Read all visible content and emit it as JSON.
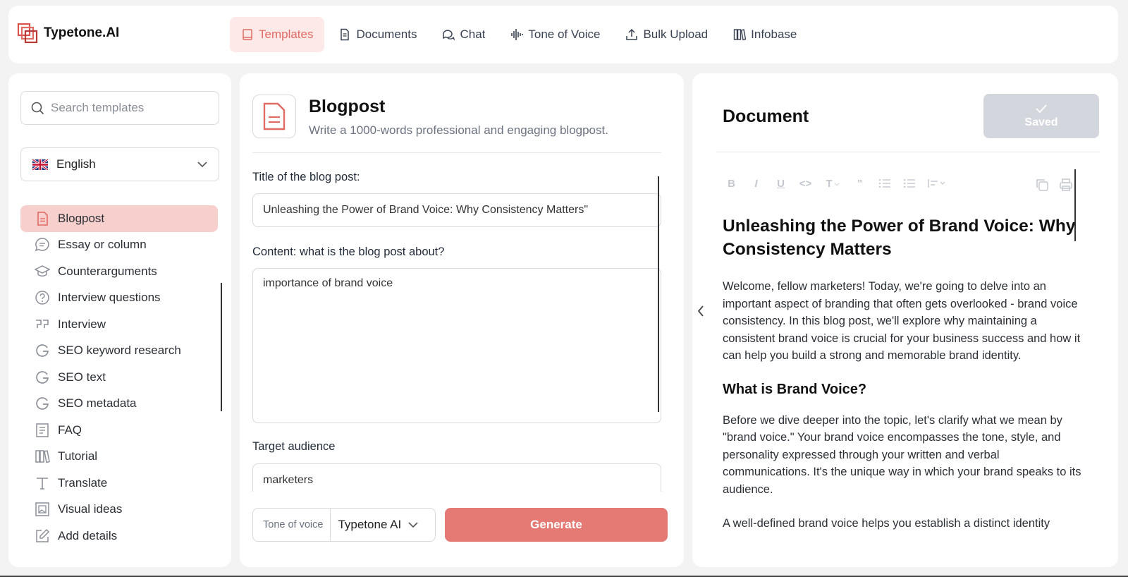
{
  "app": {
    "name": "Typetone.AI"
  },
  "nav": [
    {
      "label": "Templates",
      "icon": "book-icon",
      "active": true
    },
    {
      "label": "Documents",
      "icon": "document-icon"
    },
    {
      "label": "Chat",
      "icon": "chat-icon"
    },
    {
      "label": "Tone of Voice",
      "icon": "soundwave-icon"
    },
    {
      "label": "Bulk Upload",
      "icon": "upload-icon"
    },
    {
      "label": "Infobase",
      "icon": "library-icon"
    }
  ],
  "sidebar": {
    "search_placeholder": "Search templates",
    "language": "English",
    "templates": [
      {
        "label": "Blogpost",
        "icon": "document-icon",
        "active": true
      },
      {
        "label": "Essay or column",
        "icon": "speech-bubble-icon"
      },
      {
        "label": "Counterarguments",
        "icon": "graduation-cap-icon"
      },
      {
        "label": "Interview questions",
        "icon": "question-circle-icon"
      },
      {
        "label": "Interview",
        "icon": "quote-icon"
      },
      {
        "label": "SEO keyword research",
        "icon": "google-icon"
      },
      {
        "label": "SEO text",
        "icon": "google-icon"
      },
      {
        "label": "SEO metadata",
        "icon": "google-icon"
      },
      {
        "label": "FAQ",
        "icon": "list-document-icon"
      },
      {
        "label": "Tutorial",
        "icon": "library-icon"
      },
      {
        "label": "Translate",
        "icon": "text-icon"
      },
      {
        "label": "Visual ideas",
        "icon": "image-icon"
      },
      {
        "label": "Add details",
        "icon": "edit-icon"
      }
    ]
  },
  "form": {
    "title": "Blogpost",
    "subtitle": "Write a 1000-words professional and engaging blogpost.",
    "title_label": "Title of the blog post:",
    "title_value": "Unleashing the Power of Brand Voice: Why Consistency Matters\"",
    "content_label": "Content: what is the blog post about?",
    "content_value": "importance of brand voice",
    "audience_label": "Target audience",
    "audience_value": "marketers",
    "tone_label": "Tone of voice",
    "tone_value": "Typetone AI",
    "generate_label": "Generate"
  },
  "document": {
    "heading": "Document",
    "saved_label": "Saved",
    "h1": "Unleashing the Power of Brand Voice: Why Consistency Matters",
    "p1": "Welcome, fellow marketers! Today, we're going to delve into an important aspect of branding that often gets overlooked - brand voice consistency. In this blog post, we'll explore why maintaining a consistent brand voice is crucial for your business success and how it can help you build a strong and memorable brand identity.",
    "h2": "What is Brand Voice?",
    "p2": "Before we dive deeper into the topic, let's clarify what we mean by \"brand voice.\" Your brand voice encompasses the tone, style, and personality expressed through your written and verbal communications. It's the unique way in which your brand speaks to its audience.",
    "p3": "A well-defined brand voice helps you establish a distinct identity"
  },
  "colors": {
    "accent": "#e06a64",
    "accent_bg": "#fde9e7",
    "generate": "#e57a74",
    "saved": "#d3d7dd"
  }
}
